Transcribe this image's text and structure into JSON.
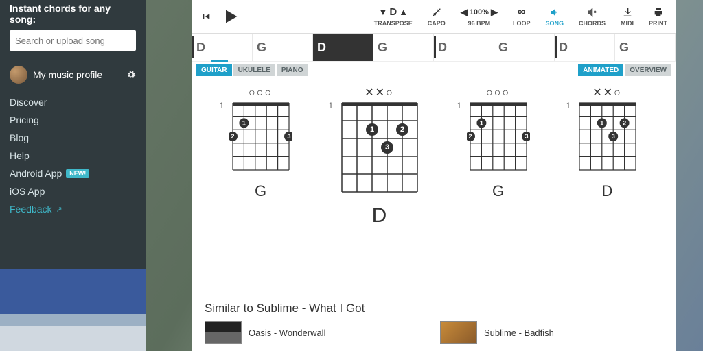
{
  "sidebar": {
    "heading": "Instant chords for any song:",
    "search_placeholder": "Search or upload song",
    "profile_label": "My music profile",
    "nav": [
      {
        "label": "Discover"
      },
      {
        "label": "Pricing"
      },
      {
        "label": "Blog"
      },
      {
        "label": "Help"
      },
      {
        "label": "Android App",
        "badge": "NEW!"
      },
      {
        "label": "iOS App"
      },
      {
        "label": "Feedback",
        "feedback": true
      }
    ]
  },
  "toolbar": {
    "transpose": {
      "center": "D",
      "label": "TRANSPOSE"
    },
    "capo": {
      "label": "CAPO"
    },
    "tempo": {
      "pct": "100%",
      "bpm": "96 BPM"
    },
    "loop": {
      "label": "LOOP"
    },
    "song": {
      "label": "SONG"
    },
    "chords": {
      "label": "CHORDS"
    },
    "midi": {
      "label": "MIDI"
    },
    "print": {
      "label": "PRINT"
    }
  },
  "timeline": [
    "D",
    "G",
    "D",
    "G",
    "D",
    "G",
    "D",
    "G"
  ],
  "instrument_tabs": [
    "GUITAR",
    "UKULELE",
    "PIANO"
  ],
  "view_tabs": [
    "ANIMATED",
    "OVERVIEW"
  ],
  "diagrams": [
    {
      "open": "  ○○○",
      "name": "G",
      "fret": "1",
      "big": false
    },
    {
      "open": "✕✕○",
      "name": "D",
      "fret": "1",
      "big": true
    },
    {
      "open": "  ○○○",
      "name": "G",
      "fret": "1",
      "big": false
    },
    {
      "open": "✕✕○",
      "name": "D",
      "fret": "1",
      "big": false
    }
  ],
  "similar": {
    "heading": "Similar to Sublime - What I Got",
    "songs": [
      {
        "title": "Oasis - Wonderwall"
      },
      {
        "title": "Sublime - Badfish"
      }
    ]
  }
}
